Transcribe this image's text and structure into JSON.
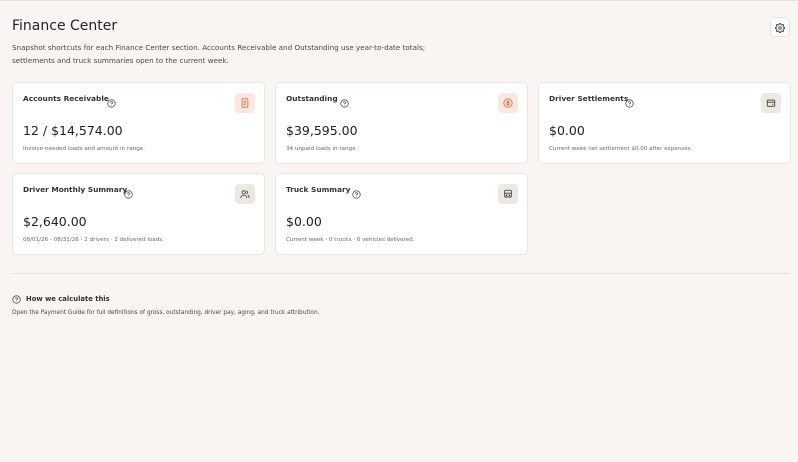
{
  "header": {
    "title": "Finance Center",
    "subtitle": "Snapshot shortcuts for each Finance Center section. Accounts Receivable and Outstanding use year-to-date totals; settlements and truck summaries open to the current week."
  },
  "cards": [
    {
      "label": "Accounts Receivable",
      "value": "12 / $14,574.00",
      "description": "Invoice-needed loads and amount in range.",
      "icon": "invoice-icon",
      "icon_bg": "#fbe7df",
      "icon_color": "#d76c4a"
    },
    {
      "label": "Outstanding",
      "value": "$39,595.00",
      "description": "34 unpaid loads in range.",
      "icon": "dollar-circle-icon",
      "icon_bg": "#fbe7df",
      "icon_color": "#d76c4a"
    },
    {
      "label": "Driver Settlements",
      "value": "$0.00",
      "description": "Current week net settlement $0.00 after expenses.",
      "icon": "wallet-icon",
      "icon_bg": "#ece9e3",
      "icon_color": "#3a3a3a"
    },
    {
      "label": "Driver Monthly Summary",
      "value": "$2,640.00",
      "description": "08/01/26 - 08/31/26 · 2 drivers · 2 delivered loads.",
      "icon": "users-icon",
      "icon_bg": "#ece9e3",
      "icon_color": "#3a3a3a"
    },
    {
      "label": "Truck Summary",
      "value": "$0.00",
      "description": "Current week · 0 trucks · 0 vehicles delivered.",
      "icon": "truck-icon",
      "icon_bg": "#ece9e3",
      "icon_color": "#3a3a3a"
    }
  ],
  "footer": {
    "how_label": "How we calculate this",
    "guide_text": "Open the Payment Guide for full definitions of gross, outstanding, driver pay, aging, and truck attribution."
  }
}
